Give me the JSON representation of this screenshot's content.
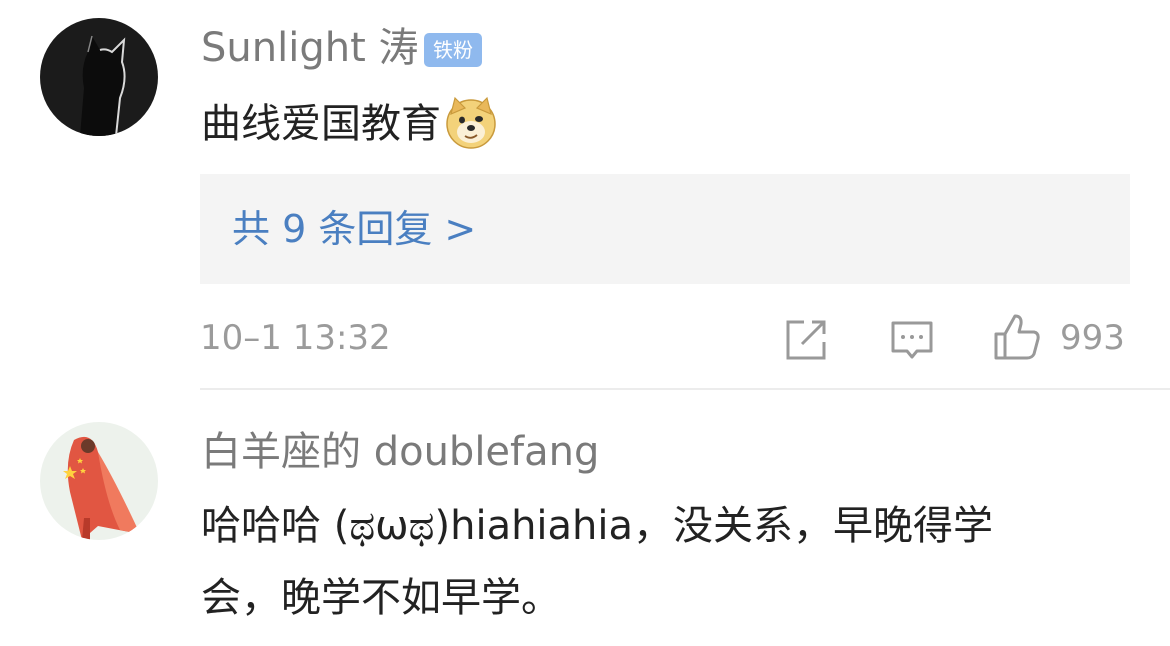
{
  "comments": [
    {
      "username": "Sunlight 涛",
      "badge": "铁粉",
      "text": "曲线爱国教育",
      "emoji_icon": "doge-emoji-icon",
      "replies_label": "共 9 条回复 >",
      "timestamp": "10–1 13:32",
      "like_count": "993"
    },
    {
      "username": "白羊座的 doublefang",
      "text_line1": "哈哈哈 (ಥωಥ)hiahiahia，没关系，早晚得学",
      "text_line2": "会，晚学不如早学。"
    }
  ],
  "colors": {
    "username": "#7a7a7a",
    "reply_link": "#4a7fc1",
    "badge_bg": "#8fb9ee",
    "meta": "#9b9b9b",
    "reply_box_bg": "#f4f4f4"
  }
}
